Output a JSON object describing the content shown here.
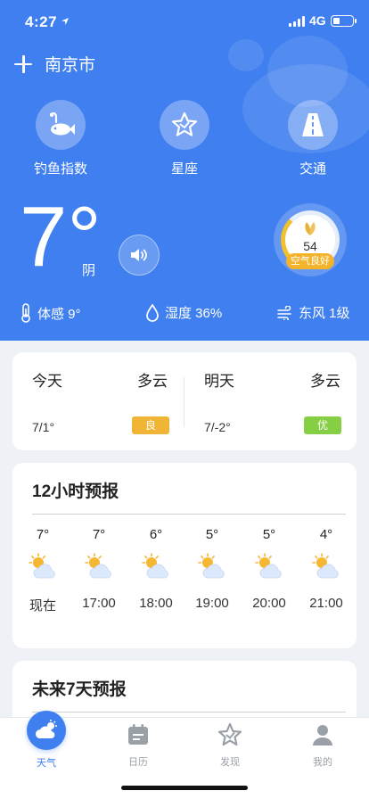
{
  "status_bar": {
    "time": "4:27",
    "network": "4G"
  },
  "header": {
    "city": "南京市"
  },
  "features": [
    {
      "label": "钓鱼指数",
      "icon": "fishing-icon"
    },
    {
      "label": "星座",
      "icon": "constellation-icon"
    },
    {
      "label": "交通",
      "icon": "traffic-icon"
    }
  ],
  "current": {
    "temperature": "7°",
    "condition": "阴",
    "aqi_value": "54",
    "aqi_label": "空气良好",
    "feels_like": "体感 9°",
    "humidity": "湿度 36%",
    "wind": "东风 1级"
  },
  "two_day": [
    {
      "day": "今天",
      "condition": "多云",
      "range": "7/1°",
      "quality": "良",
      "quality_color": "#f0b534"
    },
    {
      "day": "明天",
      "condition": "多云",
      "range": "7/-2°",
      "quality": "优",
      "quality_color": "#86cf45"
    }
  ],
  "hourly": {
    "title": "12小时预报",
    "items": [
      {
        "temp": "7°",
        "time": "现在"
      },
      {
        "temp": "7°",
        "time": "17:00"
      },
      {
        "temp": "6°",
        "time": "18:00"
      },
      {
        "temp": "5°",
        "time": "19:00"
      },
      {
        "temp": "5°",
        "time": "20:00"
      },
      {
        "temp": "4°",
        "time": "21:00"
      }
    ]
  },
  "weekly": {
    "title": "未来7天预报"
  },
  "tabs": [
    {
      "label": "天气",
      "icon": "weather-icon",
      "active": true
    },
    {
      "label": "日历",
      "icon": "calendar-icon",
      "active": false
    },
    {
      "label": "发现",
      "icon": "discover-icon",
      "active": false
    },
    {
      "label": "我的",
      "icon": "profile-icon",
      "active": false
    }
  ],
  "colors": {
    "primary": "#3f7ff0",
    "aqi_good": "#f3b32b"
  }
}
